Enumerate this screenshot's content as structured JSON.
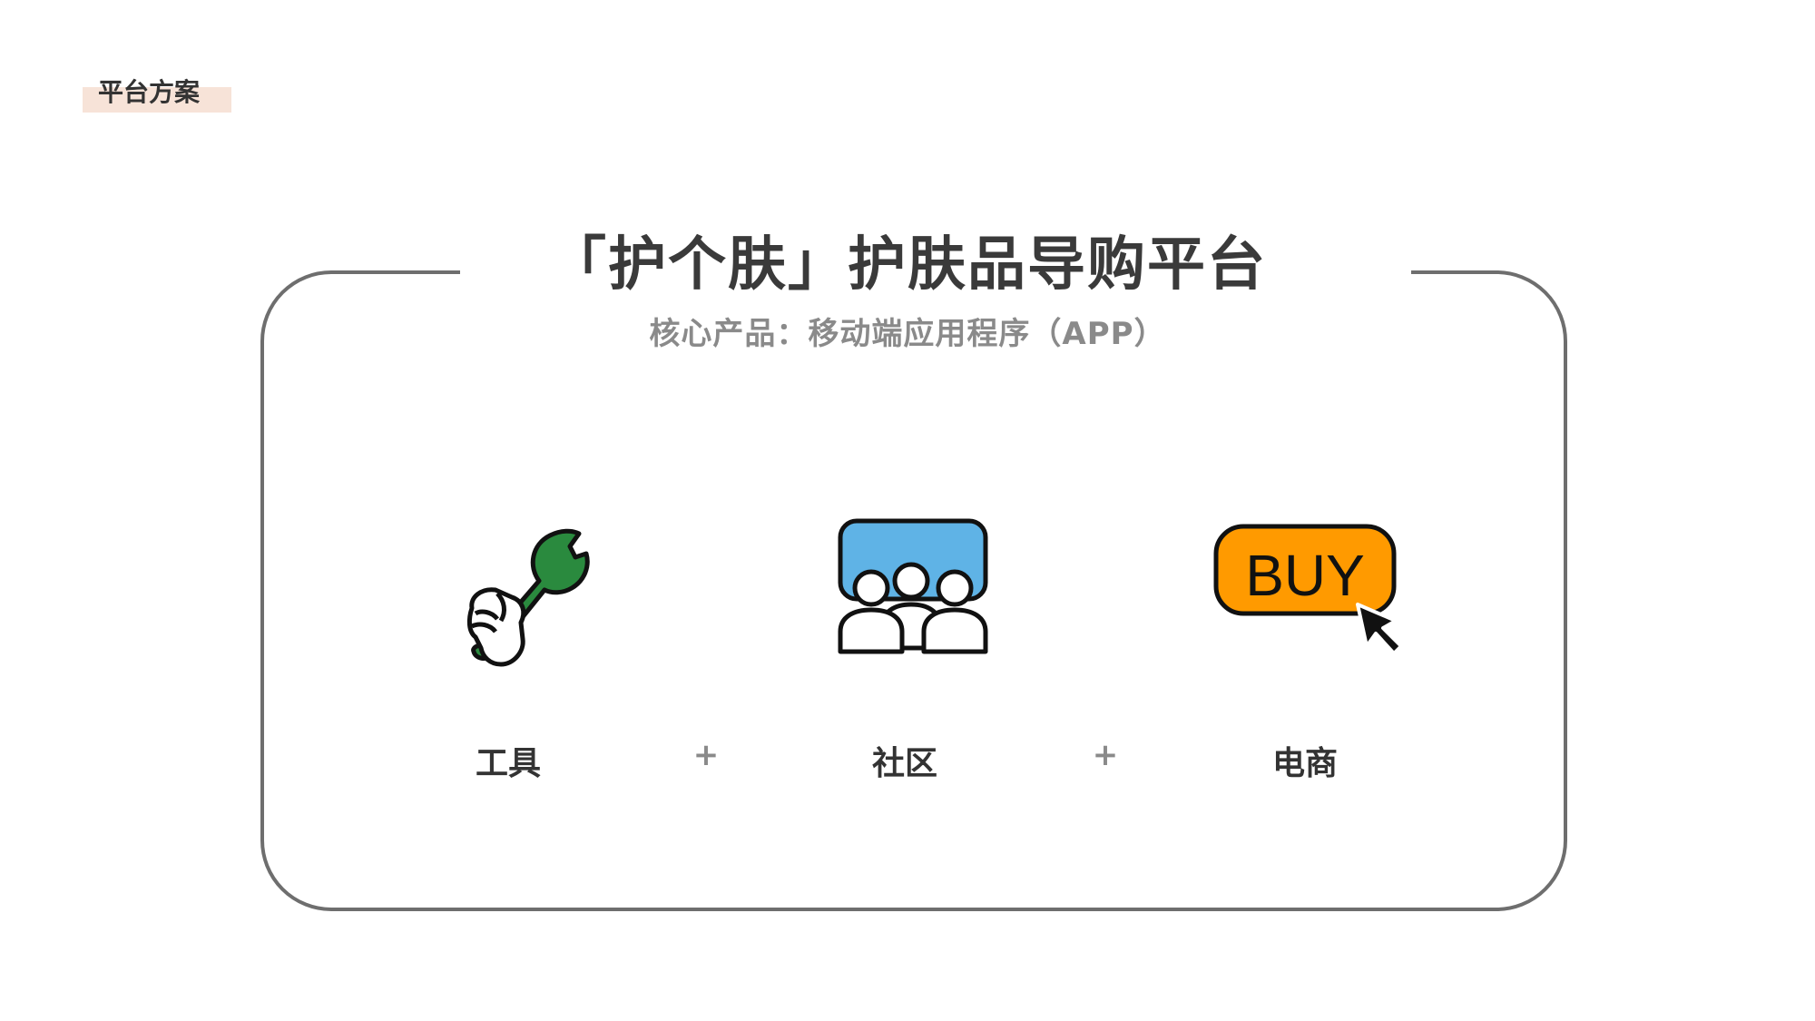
{
  "section_tag": "平台方案",
  "title": "「护个肤」护肤品导购平台",
  "subtitle": "核心产品：移动端应用程序（APP）",
  "features": [
    {
      "label": "工具",
      "icon": "wrench-hand-icon"
    },
    {
      "label": "社区",
      "icon": "community-people-icon"
    },
    {
      "label": "电商",
      "icon": "buy-button-icon",
      "badge_text": "BUY"
    }
  ],
  "connector": "+",
  "colors": {
    "tag_bg": "#f7e3d8",
    "frame": "#6e6e6e",
    "title": "#3a3a3a",
    "subtitle": "#8a8a8a",
    "tool_green": "#2a8a3e",
    "community_blue": "#5fb3e6",
    "buy_orange": "#ff9a00"
  }
}
